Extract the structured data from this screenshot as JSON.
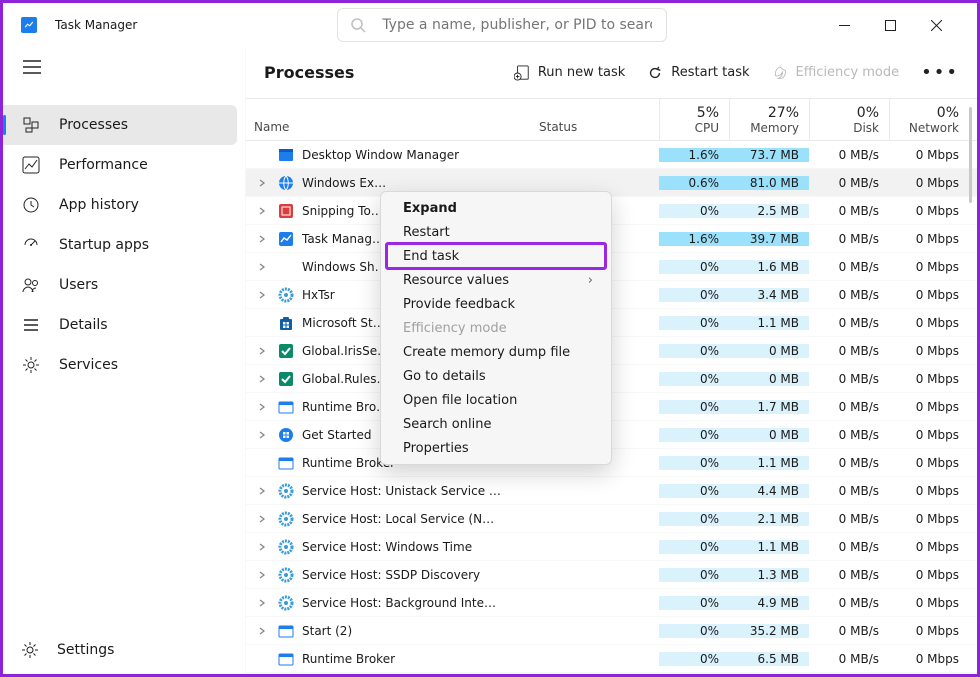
{
  "app": {
    "name": "Task Manager"
  },
  "search": {
    "placeholder": "Type a name, publisher, or PID to search"
  },
  "sidebar": {
    "items": [
      {
        "label": "Processes"
      },
      {
        "label": "Performance"
      },
      {
        "label": "App history"
      },
      {
        "label": "Startup apps"
      },
      {
        "label": "Users"
      },
      {
        "label": "Details"
      },
      {
        "label": "Services"
      }
    ],
    "settings": "Settings"
  },
  "toolbar": {
    "title": "Processes",
    "run_new_task": "Run new task",
    "restart_task": "Restart task",
    "efficiency": "Efficiency mode"
  },
  "columns": {
    "name": "Name",
    "status": "Status",
    "cpu": {
      "pct": "5%",
      "label": "CPU"
    },
    "memory": {
      "pct": "27%",
      "label": "Memory"
    },
    "disk": {
      "pct": "0%",
      "label": "Disk"
    },
    "network": {
      "pct": "0%",
      "label": "Network"
    }
  },
  "rows": [
    {
      "expand": false,
      "icon": "window",
      "name": "Desktop Window Manager",
      "cpu": "1.6%",
      "mem": "73.7 MB",
      "disk": "0 MB/s",
      "net": "0 Mbps",
      "hot": true
    },
    {
      "expand": true,
      "icon": "globe",
      "name": "Windows Ex…",
      "cpu": "0.6%",
      "mem": "81.0 MB",
      "disk": "0 MB/s",
      "net": "0 Mbps",
      "hot": true,
      "selected": true
    },
    {
      "expand": true,
      "icon": "snip",
      "name": "Snipping To…",
      "cpu": "0%",
      "mem": "2.5 MB",
      "disk": "0 MB/s",
      "net": "0 Mbps"
    },
    {
      "expand": true,
      "icon": "tm",
      "name": "Task Manag…",
      "cpu": "1.6%",
      "mem": "39.7 MB",
      "disk": "0 MB/s",
      "net": "0 Mbps",
      "hot": true
    },
    {
      "expand": true,
      "icon": "blank",
      "name": "Windows Sh…",
      "cpu": "0%",
      "mem": "1.6 MB",
      "disk": "0 MB/s",
      "net": "0 Mbps"
    },
    {
      "expand": true,
      "icon": "gear2",
      "name": "HxTsr",
      "cpu": "0%",
      "mem": "3.4 MB",
      "disk": "0 MB/s",
      "net": "0 Mbps"
    },
    {
      "expand": false,
      "icon": "msstore",
      "name": "Microsoft St…",
      "cpu": "0%",
      "mem": "1.1 MB",
      "disk": "0 MB/s",
      "net": "0 Mbps"
    },
    {
      "expand": true,
      "icon": "iris",
      "name": "Global.IrisSe…",
      "cpu": "0%",
      "mem": "0 MB",
      "disk": "0 MB/s",
      "net": "0 Mbps"
    },
    {
      "expand": true,
      "icon": "iris",
      "name": "Global.Rules…",
      "cpu": "0%",
      "mem": "0 MB",
      "disk": "0 MB/s",
      "net": "0 Mbps"
    },
    {
      "expand": true,
      "icon": "box",
      "name": "Runtime Bro…",
      "cpu": "0%",
      "mem": "1.7 MB",
      "disk": "0 MB/s",
      "net": "0 Mbps"
    },
    {
      "expand": true,
      "icon": "start",
      "name": "Get Started",
      "cpu": "0%",
      "mem": "0 MB",
      "disk": "0 MB/s",
      "net": "0 Mbps"
    },
    {
      "expand": false,
      "icon": "box",
      "name": "Runtime Broker",
      "cpu": "0%",
      "mem": "1.1 MB",
      "disk": "0 MB/s",
      "net": "0 Mbps"
    },
    {
      "expand": true,
      "icon": "gear2",
      "name": "Service Host: Unistack Service …",
      "cpu": "0%",
      "mem": "4.4 MB",
      "disk": "0 MB/s",
      "net": "0 Mbps"
    },
    {
      "expand": true,
      "icon": "gear2",
      "name": "Service Host: Local Service (N…",
      "cpu": "0%",
      "mem": "2.1 MB",
      "disk": "0 MB/s",
      "net": "0 Mbps"
    },
    {
      "expand": true,
      "icon": "gear2",
      "name": "Service Host: Windows Time",
      "cpu": "0%",
      "mem": "1.1 MB",
      "disk": "0 MB/s",
      "net": "0 Mbps"
    },
    {
      "expand": true,
      "icon": "gear2",
      "name": "Service Host: SSDP Discovery",
      "cpu": "0%",
      "mem": "1.3 MB",
      "disk": "0 MB/s",
      "net": "0 Mbps"
    },
    {
      "expand": true,
      "icon": "gear2",
      "name": "Service Host: Background Inte…",
      "cpu": "0%",
      "mem": "4.9 MB",
      "disk": "0 MB/s",
      "net": "0 Mbps"
    },
    {
      "expand": true,
      "icon": "box",
      "name": "Start (2)",
      "cpu": "0%",
      "mem": "35.2 MB",
      "disk": "0 MB/s",
      "net": "0 Mbps"
    },
    {
      "expand": false,
      "icon": "box",
      "name": "Runtime Broker",
      "cpu": "0%",
      "mem": "6.5 MB",
      "disk": "0 MB/s",
      "net": "0 Mbps"
    }
  ],
  "context": {
    "items": [
      {
        "label": "Expand",
        "bold": true
      },
      {
        "label": "Restart"
      },
      {
        "label": "End task",
        "highlight": true
      },
      {
        "label": "Resource values",
        "submenu": true
      },
      {
        "label": "Provide feedback"
      },
      {
        "label": "Efficiency mode",
        "disabled": true
      },
      {
        "label": "Create memory dump file"
      },
      {
        "label": "Go to details"
      },
      {
        "label": "Open file location"
      },
      {
        "label": "Search online"
      },
      {
        "label": "Properties"
      }
    ]
  }
}
